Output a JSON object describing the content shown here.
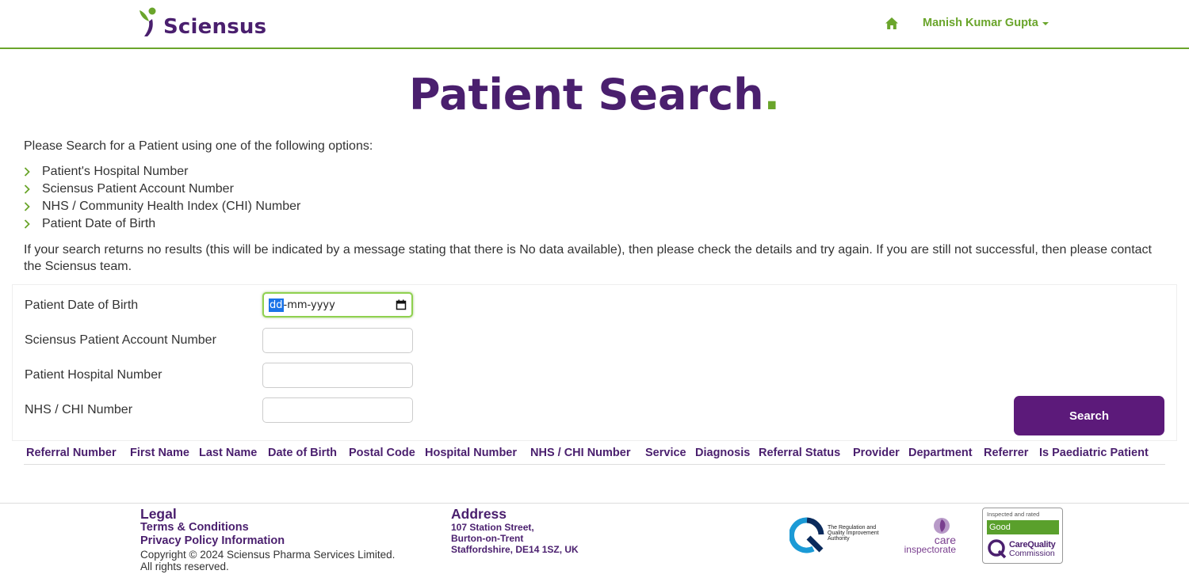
{
  "header": {
    "brand": "Sciensus",
    "user_name": "Manish Kumar Gupta",
    "home_icon": "home-icon",
    "accent": "#6aa52b",
    "brand_color": "#4a1f6e"
  },
  "page": {
    "title": "Patient Search",
    "title_dot": "."
  },
  "intro": {
    "lead": "Please Search for a Patient using one of the following options:",
    "options": [
      "Patient's Hospital Number",
      "Sciensus Patient Account Number",
      "NHS / Community Health Index (CHI) Number",
      "Patient Date of Birth"
    ],
    "note": "If your search returns no results (this will be indicated by a message stating that there is No data available), then please check the details and try again. If you are still not successful, then please contact the Sciensus team."
  },
  "form": {
    "dob_label": "Patient Date of Birth",
    "dob_dd": "dd",
    "dob_rest": "-mm-yyyy",
    "account_label": "Sciensus Patient Account Number",
    "account_value": "",
    "hospital_label": "Patient Hospital Number",
    "hospital_value": "",
    "nhs_label": "NHS / CHI Number",
    "nhs_value": "",
    "search_button": "Search",
    "button_color": "#5c1a7a"
  },
  "results": {
    "columns": [
      "Referral Number",
      "First Name",
      "Last Name",
      "Date of Birth",
      "Postal Code",
      "Hospital Number",
      "NHS / CHI Number",
      "Service",
      "Diagnosis",
      "Referral Status",
      "Provider",
      "Department",
      "Referrer",
      "Is Paediatric Patient"
    ]
  },
  "footer": {
    "legal_heading": "Legal",
    "terms_link": "Terms & Conditions",
    "privacy_link": "Privacy Policy Information",
    "copyright": "Copyright © 2024 Sciensus Pharma Services Limited.",
    "rights": "All rights reserved.",
    "address_heading": "Address",
    "address_lines": [
      "107 Station Street,",
      "Burton-on-Trent",
      "Staffordshire, DE14 1SZ, UK"
    ],
    "rqia_text": "The Regulation and Quality Improvement Authority",
    "care_word": "care",
    "inspectorate_word": "inspectorate",
    "cqc_top": "Inspected and rated",
    "cqc_rating": "Good",
    "cqc_name_1": "CareQuality",
    "cqc_name_2": "Commission"
  }
}
